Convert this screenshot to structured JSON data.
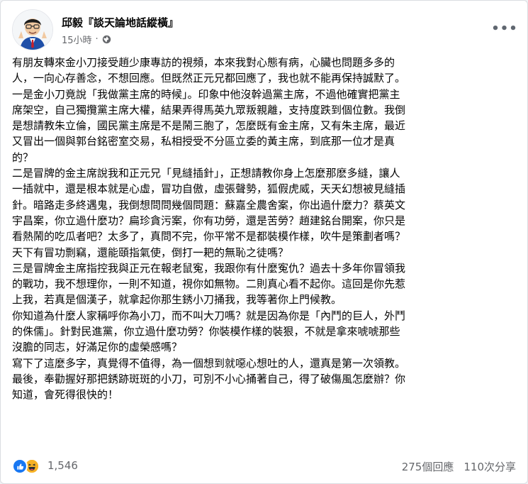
{
  "post": {
    "author": "邱毅『談天論地話縱橫』",
    "time": "15小時",
    "separator": "·",
    "privacy_icon": "globe-icon",
    "more_icon": "more-options-icon",
    "lines": [
      "有朋友轉來金小刀接受趙少康專訪的視頻，本來我對心態有病，心臟也問題多多的",
      "人，一向心存善念，不想回應。但既然正元兄都回應了，我也就不能再保持誠默了。",
      "一是金小刀竟說「我做黨主席的時候」。印象中他沒幹過黨主席，不過他確實把黨主",
      "席架空，自己獨攬黨主席大權，結果弄得馬英九眾叛親離，支持度跌到個位數。我倒",
      "是想請教朱立倫，國民黨主席是不是鬧三胞了，怎麼既有金主席，又有朱主席，最近",
      "又冒出一個與郭台銘密室交易，私相授受不分區立委的黃主席，到底那一位才是真",
      "的？",
      "二是冒牌的金主席說我和正元兄「見縫插針」，正想請教你身上怎麼那麽多縫，讓人",
      "一插就中，還是根本就是心虛，冒功自傲，虛張聲勢，狐假虎威，天天幻想被見縫插",
      "針。暗路走多終遇鬼，我倒想問問幾個問題：蘇嘉全農舍案，你出過什麼力？蔡英文",
      "宇昌案，你立過什麼功？扁珍貪污案，你有功勞，還是苦勞？趙建銘台開案，你只是",
      "看熱鬧的吃瓜者吧？太多了，真問不完，你平常不是都裝模作樣，吹牛是策劃者嗎？",
      "天下有冒功剽竊，還能頤指氣使，倒打一耙的無恥之徒嗎？",
      "三是冒牌金主席指控我與正元在報老鼠寃，我跟你有什麼寃仇？過去十多年你冒領我",
      "的戰功，我不想理你，一則不知道，視你如無物。二則真心看不起你。這回是你先惹",
      "上我，若真是個漢子，就拿起你那生銹小刀捅我，我等著你上門候教。",
      "你知道為什麼人家稱呼你為小刀，而不叫大刀嗎？就是因為你是「內鬥的巨人，外鬥",
      "的侏儒」。針對民進黨，你立過什麼功勞？你裝模作樣的裝狠，不就是拿來唬唬那些",
      "沒膽的同志，好滿足你的虛榮感嗎？",
      "寫下了這麼多字，真覺得不值得，為一個想到就噁心想吐的人，還真是第一次領教。",
      "最後，奉勸握好那把銹跡斑斑的小刀，可別不小心捅著自己，得了破傷風怎麼辦？你",
      "知道，會死得很快的！"
    ]
  },
  "reactions": {
    "icons": [
      "like-icon",
      "haha-icon"
    ],
    "count": "1,546"
  },
  "stats": {
    "comments": "275個回應",
    "shares": "110次分享"
  },
  "colors": {
    "like_blue": "#1877f2",
    "haha_yellow": "#f7b125",
    "secondary_text": "#65676b"
  }
}
